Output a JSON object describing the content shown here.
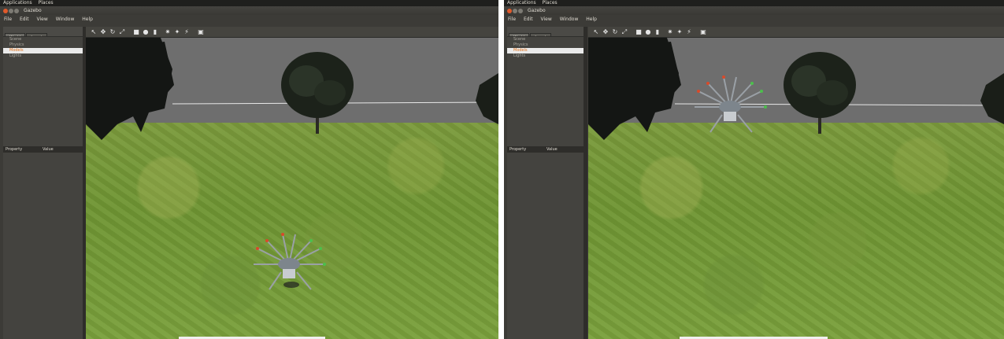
{
  "desktop": {
    "topbar": {
      "applications": "Applications",
      "places": "Places"
    }
  },
  "window": {
    "title": "Gazebo",
    "menu": [
      "File",
      "Edit",
      "View",
      "Window",
      "Help"
    ]
  },
  "left_panel": {
    "tabs": [
      "World",
      "Insert"
    ],
    "tree": [
      "Scene",
      "Physics",
      "Models",
      "Lights"
    ],
    "selected_item": "Models",
    "property_headers": {
      "property": "Property",
      "value": "Value"
    }
  },
  "toolbar_icons": [
    "select-icon",
    "translate-icon",
    "rotate-icon",
    "scale-icon",
    "box-icon",
    "sphere-icon",
    "cylinder-icon",
    "point-light-icon",
    "spot-light-icon",
    "directional-light-icon",
    "screenshot-icon"
  ],
  "colors": {
    "selected_text": "#e0701a",
    "ground": "#7a9d3a",
    "sky": "#6e6e6e",
    "close_button": "#e05a2b"
  }
}
